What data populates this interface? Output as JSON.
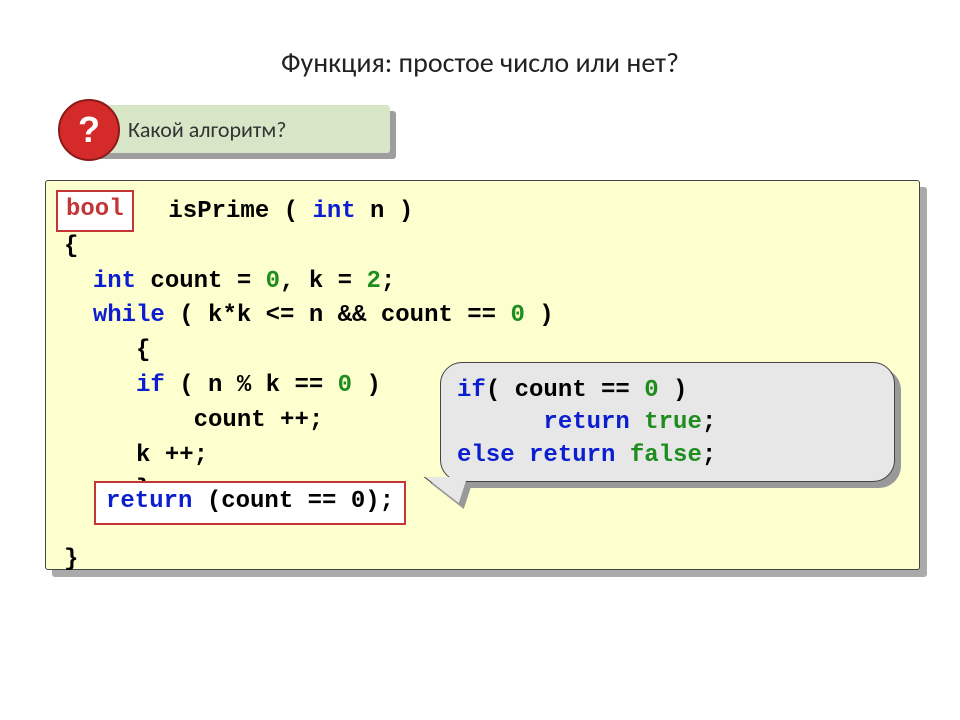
{
  "title": "Функция: простое число или нет?",
  "question": {
    "mark": "?",
    "text": "Какой алгоритм?"
  },
  "bool_label": "bool",
  "code": {
    "l1_fn": " isPrime ",
    "l1_open": "( ",
    "l1_int": "int",
    "l1_n": " n )",
    "l2": "{",
    "l3_int": "int",
    "l3_a": " count = ",
    "l3_v0": "0",
    "l3_b": ", k = ",
    "l3_v2": "2",
    "l3_c": ";",
    "l4_while": "while",
    "l4_a": " ( k*k <= n && count == ",
    "l4_v0": "0",
    "l4_b": " )",
    "l5": "{",
    "l6_if": "if",
    "l6_a": " ( n % k == ",
    "l6_v0": "0",
    "l6_b": " )",
    "l7": "count ++;",
    "l8": "k ++;",
    "l9": "}",
    "l10": "}"
  },
  "return_box": {
    "kw": "return",
    "rest": " (count == 0);"
  },
  "callout": {
    "c1_if": "if",
    "c1_a": "( count == ",
    "c1_v0": "0",
    "c1_b": " )",
    "c2_ret": "return",
    "c2_true": " true",
    "c2_semi": ";",
    "c3_else": "else",
    "c3_ret": " return",
    "c3_false": " false",
    "c3_semi": ";"
  }
}
